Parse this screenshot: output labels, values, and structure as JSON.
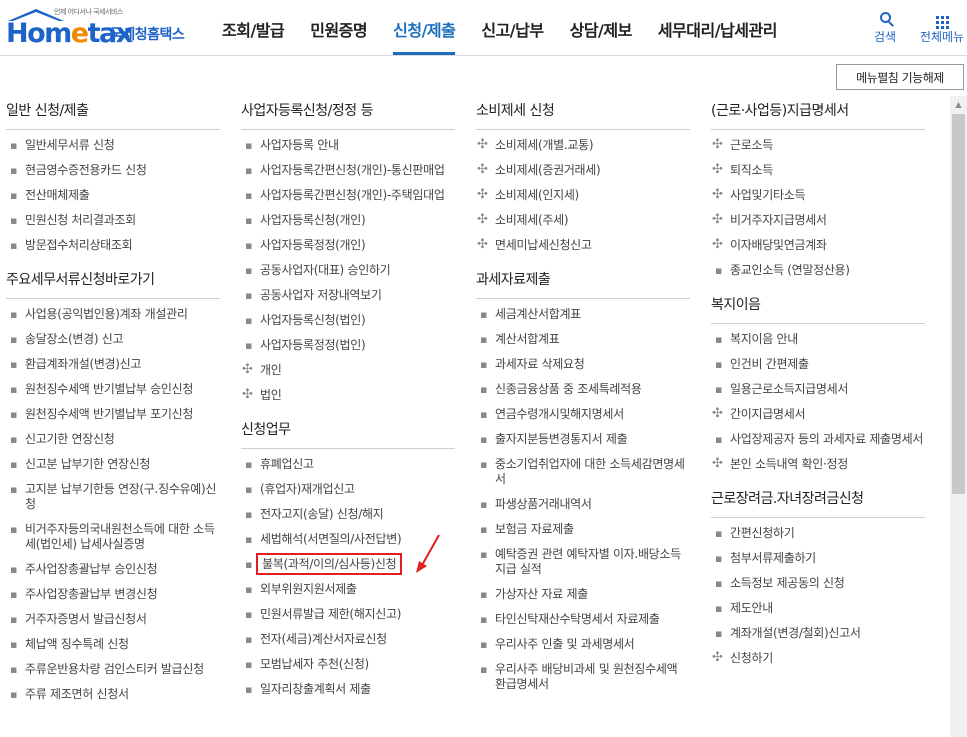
{
  "logo": {
    "tagline": "언제 어디서나 국세서비스",
    "word_home": "Hom",
    "word_e": "e",
    "word_tax": "tax",
    "korean": "국세청홈택스"
  },
  "nav": [
    {
      "label": "조회/발급"
    },
    {
      "label": "민원증명"
    },
    {
      "label": "신청/제출",
      "active": true
    },
    {
      "label": "신고/납부"
    },
    {
      "label": "상담/제보"
    },
    {
      "label": "세무대리/납세관리"
    }
  ],
  "util": {
    "search": "검색",
    "all_menu": "전체메뉴"
  },
  "toggle_button": "메뉴펼침 기능해제",
  "colors": {
    "brand": "#1e64c8",
    "accent": "#f08a00",
    "highlight_box": "#e02020"
  },
  "columns": [
    {
      "sections": [
        {
          "title": "일반 신청/제출",
          "items": [
            {
              "label": "일반세무서류 신청",
              "marker": "dot"
            },
            {
              "label": "현금영수증전용카드 신청",
              "marker": "dot"
            },
            {
              "label": "전산매체제출",
              "marker": "dot"
            },
            {
              "label": "민원신청 처리결과조회",
              "marker": "dot"
            },
            {
              "label": "방문접수처리상태조회",
              "marker": "dot"
            }
          ]
        },
        {
          "title": "주요세무서류신청바로가기",
          "items": [
            {
              "label": "사업용(공익법인용)계좌 개설관리",
              "marker": "dot"
            },
            {
              "label": "송달장소(변경) 신고",
              "marker": "dot"
            },
            {
              "label": "환급계좌개설(변경)신고",
              "marker": "dot"
            },
            {
              "label": "원천징수세액 반기별납부 승인신청",
              "marker": "dot"
            },
            {
              "label": "원천징수세액 반기별납부 포기신청",
              "marker": "dot"
            },
            {
              "label": "신고기한 연장신청",
              "marker": "dot"
            },
            {
              "label": "신고분 납부기한 연장신청",
              "marker": "dot"
            },
            {
              "label": "고지분 납부기한등 연장(구.징수유예)신청",
              "marker": "dot"
            },
            {
              "label": "비거주자등의국내원천소득에 대한 소득세(법인세) 납세사실증명",
              "marker": "dot"
            },
            {
              "label": "주사업장총괄납부 승인신청",
              "marker": "dot"
            },
            {
              "label": "주사업장총괄납부 변경신청",
              "marker": "dot"
            },
            {
              "label": "거주자증명서 발급신청서",
              "marker": "dot"
            },
            {
              "label": "체납액 징수특례 신청",
              "marker": "dot"
            },
            {
              "label": "주류운반용차량 검인스티커 발급신청",
              "marker": "dot"
            },
            {
              "label": "주류 제조면허 신청서",
              "marker": "dot"
            }
          ]
        }
      ]
    },
    {
      "sections": [
        {
          "title": "사업자등록신청/정정 등",
          "items": [
            {
              "label": "사업자등록 안내",
              "marker": "dot"
            },
            {
              "label": "사업자등록간편신청(개인)-통신판매업",
              "marker": "dot"
            },
            {
              "label": "사업자등록간편신청(개인)-주택임대업",
              "marker": "dot"
            },
            {
              "label": "사업자등록신청(개인)",
              "marker": "dot"
            },
            {
              "label": "사업자등록정정(개인)",
              "marker": "dot"
            },
            {
              "label": "공동사업자(대표) 승인하기",
              "marker": "dot"
            },
            {
              "label": "공동사업자 저장내역보기",
              "marker": "dot"
            },
            {
              "label": "사업자등록신청(법인)",
              "marker": "dot"
            },
            {
              "label": "사업자등록정정(법인)",
              "marker": "dot"
            },
            {
              "label": "개인",
              "marker": "plus"
            },
            {
              "label": "법인",
              "marker": "plus"
            }
          ]
        },
        {
          "title": "신청업무",
          "items": [
            {
              "label": "휴폐업신고",
              "marker": "dot"
            },
            {
              "label": "(휴업자)재개업신고",
              "marker": "dot"
            },
            {
              "label": "전자고지(송달) 신청/해지",
              "marker": "dot"
            },
            {
              "label": "세법해석(서면질의/사전답변)",
              "marker": "dot"
            },
            {
              "label": "불복(과적/이의/심사등)신청",
              "marker": "dot",
              "boxed": true
            },
            {
              "label": "외부위원지원서제출",
              "marker": "dot"
            },
            {
              "label": "민원서류발급 제한(해지신고)",
              "marker": "dot"
            },
            {
              "label": "전자(세금)계산서자료신청",
              "marker": "dot"
            },
            {
              "label": "모범납세자 추천(신청)",
              "marker": "dot"
            },
            {
              "label": "일자리창출계획서 제출",
              "marker": "dot"
            }
          ]
        }
      ]
    },
    {
      "sections": [
        {
          "title": "소비제세 신청",
          "items": [
            {
              "label": "소비제세(개별.교통)",
              "marker": "plus"
            },
            {
              "label": "소비제세(증권거래세)",
              "marker": "plus"
            },
            {
              "label": "소비제세(인지세)",
              "marker": "plus"
            },
            {
              "label": "소비제세(주세)",
              "marker": "plus"
            },
            {
              "label": "면세미납세신청신고",
              "marker": "plus"
            }
          ]
        },
        {
          "title": "과세자료제출",
          "items": [
            {
              "label": "세금계산서합계표",
              "marker": "dot"
            },
            {
              "label": "계산서합계표",
              "marker": "dot"
            },
            {
              "label": "과세자료 삭제요청",
              "marker": "dot"
            },
            {
              "label": "신종금융상품 중 조세특례적용",
              "marker": "dot"
            },
            {
              "label": "연금수령개시및해지명세서",
              "marker": "dot"
            },
            {
              "label": "출자지분등변경통지서 제출",
              "marker": "dot"
            },
            {
              "label": "중소기업취업자에 대한 소득세감면명세서",
              "marker": "dot"
            },
            {
              "label": "파생상품거래내역서",
              "marker": "dot"
            },
            {
              "label": "보험금 자료제출",
              "marker": "dot"
            },
            {
              "label": "예탁증권 관련 예탁자별 이자.배당소득 지급 실적",
              "marker": "dot"
            },
            {
              "label": "가상자산 자료 제출",
              "marker": "dot"
            },
            {
              "label": "타인신탁재산수탁명세서 자료제출",
              "marker": "dot"
            },
            {
              "label": "우리사주 인출 및 과세명세서",
              "marker": "dot"
            },
            {
              "label": "우리사주 배당비과세 및 원천징수세액 환급명세서",
              "marker": "dot"
            }
          ]
        }
      ]
    },
    {
      "sections": [
        {
          "title": "(근로·사업등)지급명세서",
          "items": [
            {
              "label": "근로소득",
              "marker": "plus"
            },
            {
              "label": "퇴직소득",
              "marker": "plus"
            },
            {
              "label": "사업및기타소득",
              "marker": "plus"
            },
            {
              "label": "비거주자지급명세서",
              "marker": "plus"
            },
            {
              "label": "이자배당및연금계좌",
              "marker": "plus"
            },
            {
              "label": "종교인소득 (연말정산용)",
              "marker": "dot"
            }
          ]
        },
        {
          "title": "복지이음",
          "items": [
            {
              "label": "복지이음 안내",
              "marker": "dot"
            },
            {
              "label": "인건비 간편제출",
              "marker": "dot"
            },
            {
              "label": "일용근로소득지급명세서",
              "marker": "dot"
            },
            {
              "label": "간이지급명세서",
              "marker": "plus"
            },
            {
              "label": "사업장제공자 등의 과세자료 제출명세서",
              "marker": "dot"
            },
            {
              "label": "본인 소득내역 확인·정정",
              "marker": "plus"
            }
          ]
        },
        {
          "title": "근로장려금.자녀장려금신청",
          "items": [
            {
              "label": "간편신청하기",
              "marker": "dot"
            },
            {
              "label": "첨부서류제출하기",
              "marker": "dot"
            },
            {
              "label": "소득정보 제공동의 신청",
              "marker": "dot"
            },
            {
              "label": "제도안내",
              "marker": "dot"
            },
            {
              "label": "계좌개설(변경/철회)신고서",
              "marker": "dot"
            },
            {
              "label": "신청하기",
              "marker": "plus"
            }
          ]
        }
      ]
    }
  ]
}
